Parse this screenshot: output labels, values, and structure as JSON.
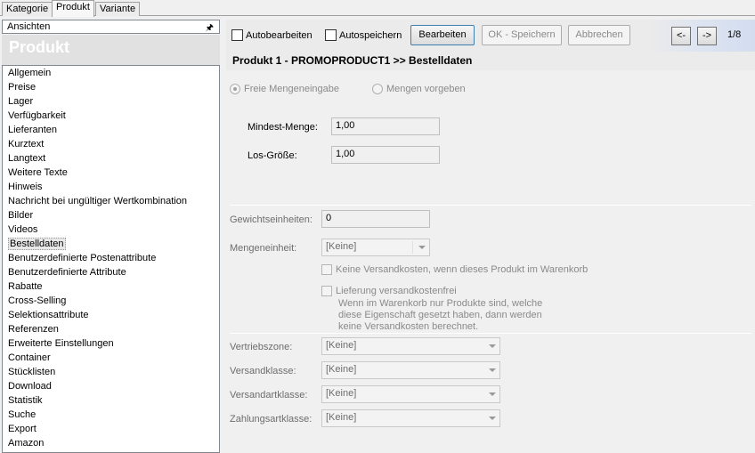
{
  "top_tabs": [
    "Kategorie",
    "Produkt",
    "Variante"
  ],
  "left": {
    "ansichten_label": "Ansichten",
    "pin_glyph": "⚓",
    "header": "Produkt",
    "items": [
      "Allgemein",
      "Preise",
      "Lager",
      "Verfügbarkeit",
      "Lieferanten",
      "Kurztext",
      "Langtext",
      "Weitere Texte",
      "Hinweis",
      "Nachricht bei ungültiger Wertkombination",
      "Bilder",
      "Videos",
      "Bestelldaten",
      "Benutzerdefinierte Postenattribute",
      "Benutzerdefinierte Attribute",
      "Rabatte",
      "Cross-Selling",
      "Selektionsattribute",
      "Referenzen",
      "Erweiterte Einstellungen",
      "Container",
      "Stücklisten",
      "Download",
      "Statistik",
      "Suche",
      "Export",
      "Amazon"
    ],
    "selected": "Bestelldaten"
  },
  "toolbar": {
    "autobearbeiten": "Autobearbeiten",
    "autospeichern": "Autospeichern",
    "bearbeiten": "Bearbeiten",
    "ok_speichern": "OK - Speichern",
    "abbrechen": "Abbrechen",
    "prev": "<-",
    "next": "->",
    "page": "1/8"
  },
  "section_title": "Produkt 1 - PROMOPRODUCT1 >> Bestelldaten",
  "form": {
    "radio_free": "Freie Mengeneingabe",
    "radio_preset": "Mengen vorgeben",
    "min_label": "Mindest-Menge:",
    "min_value": "1,00",
    "los_label": "Los-Größe:",
    "los_value": "1,00",
    "gewicht_label": "Gewichtseinheiten:",
    "gewicht_value": "0",
    "mengeneinheit_label": "Mengeneinheit:",
    "mengeneinheit_value": "[Keine]",
    "cb_versand": "Keine Versandkosten, wenn dieses Produkt im Warenkorb",
    "cb_lieferung": "Lieferung versandkostenfrei",
    "lieferung_note_1": "Wenn im Warenkorb nur Produkte sind, welche",
    "lieferung_note_2": "diese Eigenschaft gesetzt haben, dann werden",
    "lieferung_note_3": "keine Versandkosten berechnet.",
    "vertriebszone_label": "Vertriebszone:",
    "vertriebszone_value": "[Keine]",
    "versandklasse_label": "Versandklasse:",
    "versandklasse_value": "[Keine]",
    "versandartklasse_label": "Versandartklasse:",
    "versandartklasse_value": "[Keine]",
    "zahlungsartklasse_label": "Zahlungsartklasse:",
    "zahlungsartklasse_value": "[Keine]"
  }
}
